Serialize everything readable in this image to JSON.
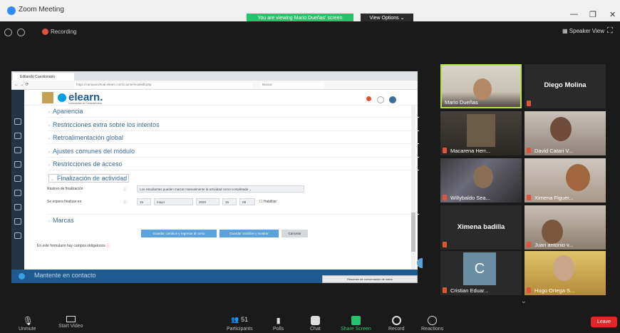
{
  "window": {
    "title": "Zoom Meeting"
  },
  "banner": {
    "viewing": "You are viewing Mario Dueñas' screen",
    "view_options": "View Options ⌄"
  },
  "topbar": {
    "recording": "Recording",
    "speaker_view": "Speaker View"
  },
  "browser": {
    "tab": "Editando Cuestionario",
    "url": "https://campusvirtual.elearn.com/course/modedit.php",
    "search": "Buscar"
  },
  "header": {
    "brand": "elearn.",
    "brand_sub": "Universidad de Panamericana"
  },
  "sections": [
    "Apariencia",
    "Restricciones extra sobre los intentos",
    "Retroalimentación global",
    "Ajustes comunes del módulo",
    "Restricciones de acceso",
    "Finalización de actividad",
    "Marcas"
  ],
  "completion": {
    "tracking_label": "Rastreo de finalización",
    "tracking_value": "Los estudiantes pueden marcar manualmente la actividad como completada",
    "expected_label": "Se espera finalizar en",
    "day": "15",
    "month": "mayo",
    "year": "2020",
    "hour": "15",
    "minute": "08",
    "enable": "Habilitar"
  },
  "buttons": {
    "save_return": "Guardar cambios y regresar al curso",
    "save_show": "Guardar cambios y mostrar",
    "cancel": "Cancelar"
  },
  "required_note": "En este formulario hay campos obligatorios",
  "footer": {
    "contact": "Mantente en contacto",
    "retention": "Resumen de conservación de datos"
  },
  "participants": [
    {
      "name": "Mario Dueñas"
    },
    {
      "name": "Diego Molina"
    },
    {
      "name": "Macarena Herr..."
    },
    {
      "name": "David Catari V..."
    },
    {
      "name": "Willybaldo Sea..."
    },
    {
      "name": "Ximena Figuer..."
    },
    {
      "name": "Ximena badilla"
    },
    {
      "name": "Juan antonio v..."
    },
    {
      "name": "Cristian Eduar...",
      "initial": "C"
    },
    {
      "name": "Hugo Ortega S..."
    }
  ],
  "toolbar": {
    "unmute": "Unmute",
    "start_video": "Start Video",
    "participants": "Participants",
    "participants_count": "51",
    "polls": "Polls",
    "chat": "Chat",
    "share": "Share Screen",
    "record": "Record",
    "reactions": "Reactions",
    "leave": "Leave"
  },
  "colors": {
    "zoom_blue": "#2d8cff",
    "share_green": "#23c46b",
    "leave_red": "#e02828",
    "active_border": "#b6e24a",
    "elearn_blue": "#1d5a96"
  }
}
